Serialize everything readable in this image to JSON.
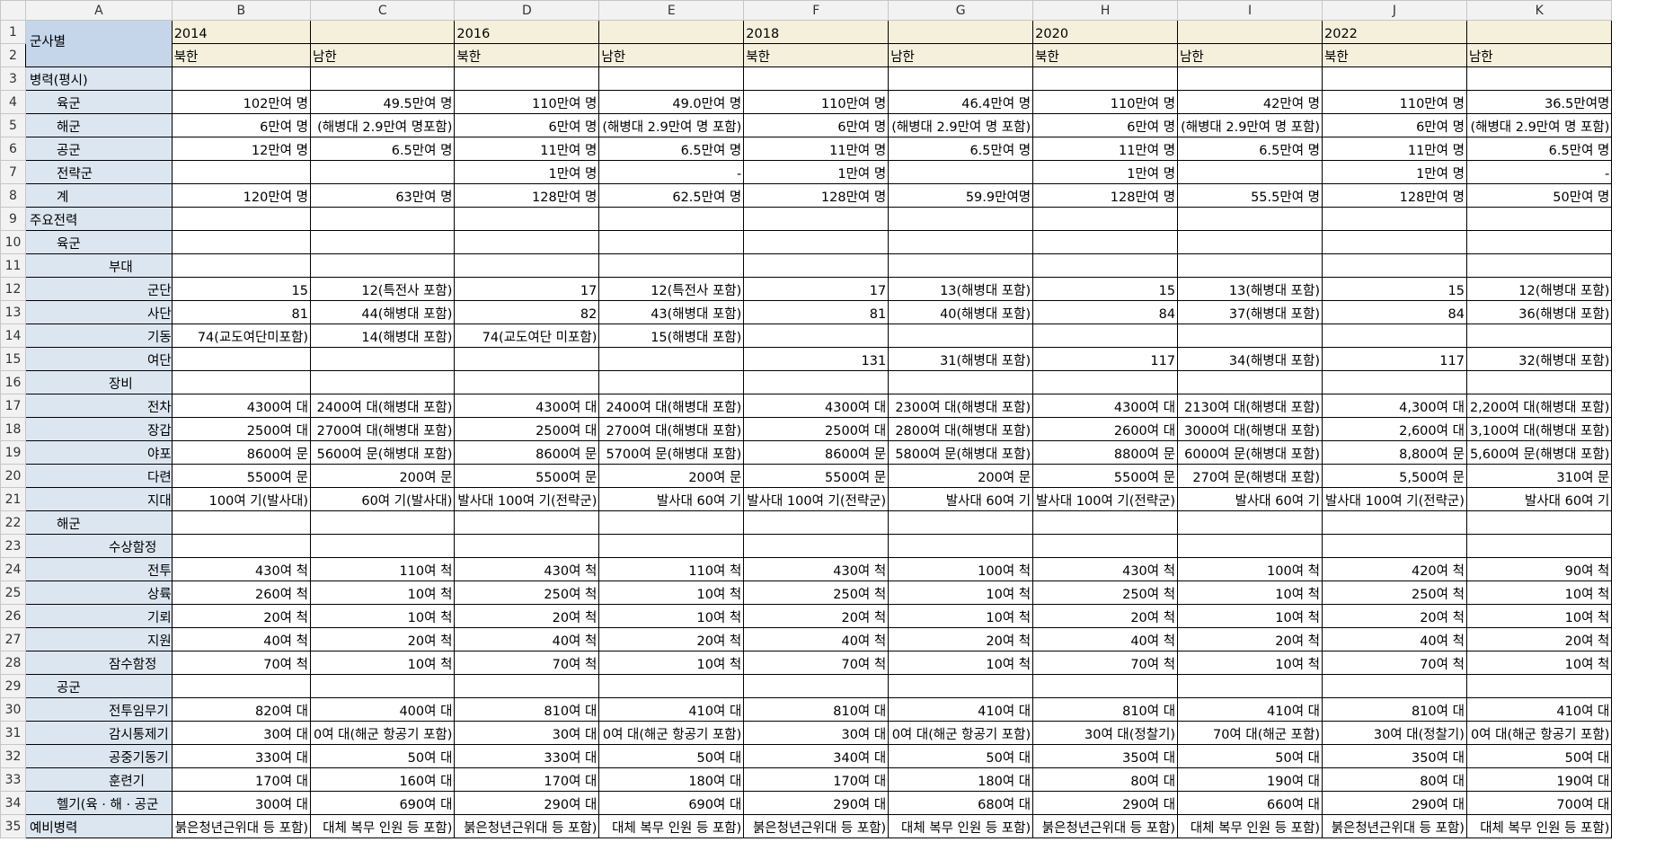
{
  "columns": [
    "A",
    "B",
    "C",
    "D",
    "E",
    "F",
    "G",
    "H",
    "I",
    "J",
    "K"
  ],
  "corner_label": "군사별",
  "years": [
    "2014",
    "2016",
    "2018",
    "2020",
    "2022"
  ],
  "sides": [
    "북한",
    "남한"
  ],
  "rows": [
    {
      "label": "병력(평시)",
      "indent": 0,
      "cells": [
        "",
        "",
        "",
        "",
        "",
        "",
        "",
        "",
        "",
        ""
      ]
    },
    {
      "label": "육군",
      "indent": 1,
      "cells": [
        "102만여 명",
        "49.5만여 명",
        "110만여 명",
        "49.0만여 명",
        "110만여 명",
        "46.4만여 명",
        "110만여 명",
        "42만여 명",
        "110만여 명",
        "36.5만여명"
      ]
    },
    {
      "label": "해군",
      "indent": 1,
      "cells": [
        "6만여 명",
        "(해병대 2.9만여 명포함)",
        "6만여 명",
        "(해병대 2.9만여 명 포함)",
        "6만여 명",
        "(해병대 2.9만여 명 포함)",
        "6만여 명",
        "(해병대 2.9만여 명 포함)",
        "6만여 명",
        "(해병대 2.9만여 명 포함)"
      ]
    },
    {
      "label": "공군",
      "indent": 1,
      "cells": [
        "12만여 명",
        "6.5만여 명",
        "11만여 명",
        "6.5만여 명",
        "11만여 명",
        "6.5만여 명",
        "11만여 명",
        "6.5만여 명",
        "11만여 명",
        "6.5만여 명"
      ]
    },
    {
      "label": "전략군",
      "indent": 1,
      "cells": [
        "",
        "",
        "1만여 명",
        "-",
        "1만여 명",
        "",
        "1만여 명",
        "",
        "1만여 명",
        "-"
      ]
    },
    {
      "label": "계",
      "indent": 1,
      "cells": [
        "120만여 명",
        "63만여 명",
        "128만여 명",
        "62.5만여 명",
        "128만여 명",
        "59.9만여명",
        "128만여 명",
        "55.5만여 명",
        "128만여 명",
        "50만여 명"
      ]
    },
    {
      "label": "주요전력",
      "indent": 0,
      "cells": [
        "",
        "",
        "",
        "",
        "",
        "",
        "",
        "",
        "",
        ""
      ]
    },
    {
      "label": "육군",
      "indent": 1,
      "cells": [
        "",
        "",
        "",
        "",
        "",
        "",
        "",
        "",
        "",
        ""
      ]
    },
    {
      "label": "부대",
      "indent": 2,
      "cells": [
        "",
        "",
        "",
        "",
        "",
        "",
        "",
        "",
        "",
        ""
      ]
    },
    {
      "label": "군단",
      "indent": 3,
      "cells": [
        "15",
        "12(특전사 포함)",
        "17",
        "12(특전사 포함)",
        "17",
        "13(해병대 포함)",
        "15",
        "13(해병대 포함)",
        "15",
        "12(해병대 포함)"
      ]
    },
    {
      "label": "사단",
      "indent": 3,
      "cells": [
        "81",
        "44(해병대 포함)",
        "82",
        "43(해병대 포함)",
        "81",
        "40(해병대 포함)",
        "84",
        "37(해병대 포함)",
        "84",
        "36(해병대 포함)"
      ]
    },
    {
      "label": "기동",
      "indent": 3,
      "cells": [
        "74(교도여단미포함)",
        "14(해병대 포함)",
        "74(교도여단 미포함)",
        "15(해병대 포함)",
        "",
        "",
        "",
        "",
        "",
        ""
      ]
    },
    {
      "label": "여단",
      "indent": 3,
      "cells": [
        "",
        "",
        "",
        "",
        "131",
        "31(해병대 포함)",
        "117",
        "34(해병대 포함)",
        "117",
        "32(해병대 포함)"
      ]
    },
    {
      "label": "장비",
      "indent": 2,
      "cells": [
        "",
        "",
        "",
        "",
        "",
        "",
        "",
        "",
        "",
        ""
      ]
    },
    {
      "label": "전차",
      "indent": 3,
      "cells": [
        "4300여 대",
        "2400여 대(해병대 포함)",
        "4300여 대",
        "2400여 대(해병대 포함)",
        "4300여 대",
        "2300여 대(해병대 포함)",
        "4300여 대",
        "2130여 대(해병대 포함)",
        "4,300여 대",
        "2,200여 대(해병대 포함)"
      ]
    },
    {
      "label": "장갑",
      "indent": 3,
      "cells": [
        "2500여 대",
        "2700여 대(해병대 포함)",
        "2500여 대",
        "2700여 대(해병대 포함)",
        "2500여 대",
        "2800여 대(해병대 포함)",
        "2600여 대",
        "3000여 대(해병대 포함)",
        "2,600여 대",
        "3,100여 대(해병대 포함)"
      ]
    },
    {
      "label": "야포",
      "indent": 3,
      "cells": [
        "8600여 문",
        "5600여 문(해병대 포함)",
        "8600여 문",
        "5700여 문(해병대 포함)",
        "8600여 문",
        "5800여 문(해병대 포함)",
        "8800여 문",
        "6000여 문(해병대 포함)",
        "8,800여 문",
        "5,600여 문(해병대 포함)"
      ]
    },
    {
      "label": "다련",
      "indent": 3,
      "cells": [
        "5500여 문",
        "200여 문",
        "5500여 문",
        "200여 문",
        "5500여 문",
        "200여 문",
        "5500여 문",
        "270여 문(해병대 포함)",
        "5,500여 문",
        "310여 문"
      ]
    },
    {
      "label": "지대",
      "indent": 3,
      "cells": [
        "100여 기(발사대)",
        "60여 기(발사대)",
        "발사대 100여 기(전략군)",
        "발사대 60여 기",
        "발사대 100여 기(전략군)",
        "발사대 60여 기",
        "발사대 100여 기(전략군)",
        "발사대 60여 기",
        "발사대 100여 기(전략군)",
        "발사대 60여 기"
      ]
    },
    {
      "label": "해군",
      "indent": 1,
      "cells": [
        "",
        "",
        "",
        "",
        "",
        "",
        "",
        "",
        "",
        ""
      ]
    },
    {
      "label": "수상함정",
      "indent": 2,
      "cells": [
        "",
        "",
        "",
        "",
        "",
        "",
        "",
        "",
        "",
        ""
      ]
    },
    {
      "label": "전투",
      "indent": 3,
      "cells": [
        "430여 척",
        "110여 척",
        "430여 척",
        "110여 척",
        "430여 척",
        "100여 척",
        "430여 척",
        "100여 척",
        "420여 척",
        "90여 척"
      ]
    },
    {
      "label": "상륙",
      "indent": 3,
      "cells": [
        "260여 척",
        "10여 척",
        "250여 척",
        "10여 척",
        "250여 척",
        "10여 척",
        "250여 척",
        "10여 척",
        "250여 척",
        "10여 척"
      ]
    },
    {
      "label": "기뢰",
      "indent": 3,
      "cells": [
        "20여 척",
        "10여 척",
        "20여 척",
        "10여 척",
        "20여 척",
        "10여 척",
        "20여 척",
        "10여 척",
        "20여 척",
        "10여 척"
      ]
    },
    {
      "label": "지원",
      "indent": 3,
      "cells": [
        "40여 척",
        "20여 척",
        "40여 척",
        "20여 척",
        "40여 척",
        "20여 척",
        "40여 척",
        "20여 척",
        "40여 척",
        "20여 척"
      ]
    },
    {
      "label": "잠수함정",
      "indent": 2,
      "cells": [
        "70여 척",
        "10여 척",
        "70여 척",
        "10여 척",
        "70여 척",
        "10여 척",
        "70여 척",
        "10여 척",
        "70여 척",
        "10여 척"
      ]
    },
    {
      "label": "공군",
      "indent": 1,
      "cells": [
        "",
        "",
        "",
        "",
        "",
        "",
        "",
        "",
        "",
        ""
      ]
    },
    {
      "label": "전투임무기",
      "indent": 2,
      "cells": [
        "820여 대",
        "400여 대",
        "810여 대",
        "410여 대",
        "810여 대",
        "410여 대",
        "810여 대",
        "410여 대",
        "810여 대",
        "410여 대"
      ]
    },
    {
      "label": "감시통제기",
      "indent": 2,
      "cells": [
        "30여 대",
        "0여 대(해군 항공기 포함)",
        "30여 대",
        "0여 대(해군 항공기 포함)",
        "30여 대",
        "0여 대(해군 항공기 포함)",
        "30여 대(정찰기)",
        "70여 대(해군 포함)",
        "30여 대(정찰기)",
        "0여 대(해군 항공기 포함)"
      ]
    },
    {
      "label": "공중기동기",
      "indent": 2,
      "cells": [
        "330여 대",
        "50여 대",
        "330여 대",
        "50여 대",
        "340여 대",
        "50여 대",
        "350여 대",
        "50여 대",
        "350여 대",
        "50여 대"
      ]
    },
    {
      "label": "훈련기",
      "indent": 2,
      "cells": [
        "170여 대",
        "160여 대",
        "170여 대",
        "180여 대",
        "170여 대",
        "180여 대",
        "80여 대",
        "190여 대",
        "80여 대",
        "190여 대"
      ]
    },
    {
      "label": "헬기(육 · 해 · 공군",
      "indent": 1,
      "cells": [
        "300여 대",
        "690여 대",
        "290여 대",
        "690여 대",
        "290여 대",
        "680여 대",
        "290여 대",
        "660여 대",
        "290여 대",
        "700여 대"
      ]
    },
    {
      "label": "예비병력",
      "indent": 0,
      "cells": [
        "붉은청년근위대 등 포함)",
        "대체 복무 인원 등 포함)",
        "붉은청년근위대 등 포함)",
        "대체 복무 인원 등 포함)",
        "붉은청년근위대 등 포함)",
        "대체 복무 인원 등 포함)",
        "붉은청년근위대 등 포함)",
        "대체 복무 인원 등 포함)",
        "붉은청년근위대 등 포함)",
        "대체 복무 인원 등 포함)"
      ]
    }
  ]
}
